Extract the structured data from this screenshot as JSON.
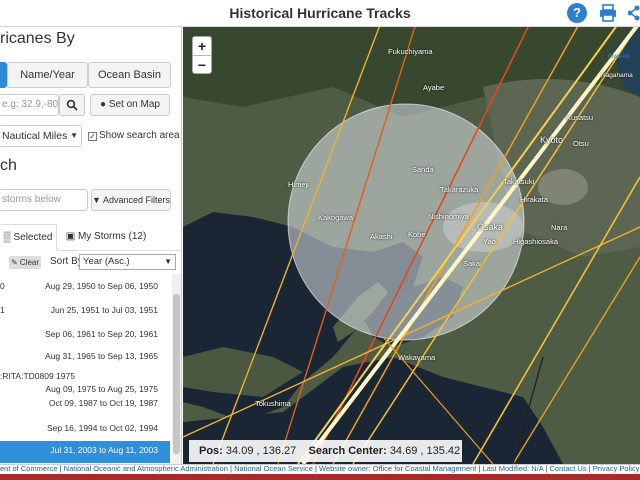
{
  "header": {
    "title": "Historical Hurricane Tracks",
    "help_glyph": "?"
  },
  "sidebar": {
    "find_title": "ricanes By",
    "search_tabs": [
      "",
      "Name/Year",
      "Ocean Basin"
    ],
    "coord_placeholder": "e.g: 32.9,-80.0)",
    "set_on_map": "Set on Map",
    "distance_unit": "Nautical Miles",
    "show_area_label": "Show search area",
    "show_area_checked": true,
    "filter_title": "ch",
    "filter_placeholder": "storms below",
    "advanced_filters": "Advanced Filters",
    "list_tabs": {
      "selected": "Selected",
      "my_storms": "My Storms (12)"
    },
    "clear_label": "Clear",
    "sort_by_label": "Sort By",
    "sort_value": "Year (Asc.)",
    "storms": [
      {
        "name": "0",
        "dates": "Aug 29, 1950 to Sep 06, 1950",
        "selected": false
      },
      {
        "name": "1",
        "dates": "Jun 25, 1951 to Jul 03, 1951",
        "selected": false
      },
      {
        "name": "",
        "dates": "Sep 06, 1961 to Sep 20, 1961",
        "selected": false
      },
      {
        "name": "",
        "dates": "Aug 31, 1965 to Sep 13, 1965",
        "selected": false
      },
      {
        "name": ":RITA:TD0809 1975",
        "dates": "Aug 09, 1975 to Aug 25, 1975",
        "selected": false
      },
      {
        "name": "",
        "dates": "Oct 09, 1987 to Oct 19, 1987",
        "selected": false
      },
      {
        "name": "",
        "dates": "Sep 16, 1994 to Oct 02, 1994",
        "selected": false
      },
      {
        "name": "",
        "dates": "Jul 31, 2003 to Aug 11, 2003",
        "selected": true
      }
    ]
  },
  "map": {
    "zoom_in": "+",
    "zoom_out": "−",
    "pos_label": "Pos:",
    "pos_value": "34.09 , 136.27",
    "center_label": "Search Center:",
    "center_value": "34.69 , 135.42",
    "places": [
      "Fukuchiyama",
      "Ayabe",
      "Kusatsu",
      "Kyoto",
      "Otsu",
      "Sanda",
      "Himeji",
      "Takarazuka",
      "Takatsuki",
      "Hirakata",
      "Nishinomiya",
      "Osaka",
      "Kakogawa",
      "Akashi",
      "Kobe",
      "Nara",
      "Yao",
      "Higashiosaka",
      "Sakai",
      "Wakayama",
      "Tokushima",
      "Nagahama",
      "Biwa-ko"
    ]
  },
  "footer": {
    "links": [
      "ent of Commerce",
      "National Oceanic and Atmospheric Administration",
      "National Ocean Service",
      "Website owner: Office for Coastal Management",
      "Last Modified: N/A",
      "Contact Us",
      "Privacy Policy"
    ]
  }
}
